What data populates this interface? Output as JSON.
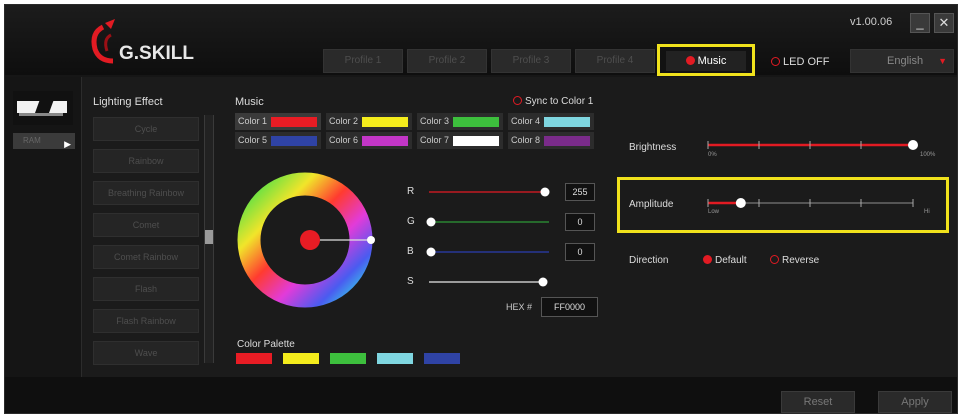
{
  "app": {
    "logo_text": "G.SKILL",
    "version": "v1.00.06",
    "minimize_symbol": "_",
    "close_symbol": "✕"
  },
  "profiles": [
    "Profile 1",
    "Profile 2",
    "Profile 3",
    "Profile 4"
  ],
  "tabs": {
    "music_label": "Music",
    "led_off_label": "LED OFF"
  },
  "language": {
    "selected": "English"
  },
  "sidebar": {
    "module_tag": "RAM"
  },
  "lighting_effect": {
    "title": "Lighting Effect",
    "items": [
      "Cycle",
      "Rainbow",
      "Breathing Rainbow",
      "Comet",
      "Comet Rainbow",
      "Flash",
      "Flash Rainbow",
      "Wave"
    ]
  },
  "music_panel": {
    "title": "Music",
    "sync_label": "Sync to Color 1",
    "colors": [
      {
        "label": "Color 1",
        "swatch": "#e81c24"
      },
      {
        "label": "Color 2",
        "swatch": "#f4ec1c"
      },
      {
        "label": "Color 3",
        "swatch": "#3dbf3d"
      },
      {
        "label": "Color 4",
        "swatch": "#7fd6e0"
      },
      {
        "label": "Color 5",
        "swatch": "#2f43a5"
      },
      {
        "label": "Color 6",
        "swatch": "#c336c7"
      },
      {
        "label": "Color 7",
        "swatch": "#ffffff"
      },
      {
        "label": "Color 8",
        "swatch": "#7a2b8a"
      }
    ],
    "selected_color": "Color 1"
  },
  "rgb": {
    "r_label": "R",
    "r_value": "255",
    "g_label": "G",
    "g_value": "0",
    "b_label": "B",
    "b_value": "0",
    "s_label": "S",
    "hex_label": "HEX #",
    "hex_value": "FF0000",
    "r_level": 1.0,
    "g_level": 0.0,
    "b_level": 0.0,
    "s_level": 1.0
  },
  "palette": {
    "title": "Color Palette",
    "colors": [
      "#e81c24",
      "#f4ec1c",
      "#3dbf3d",
      "#7fd6e0",
      "#2f43a5"
    ]
  },
  "brightness": {
    "label": "Brightness",
    "min_label": "0%",
    "max_label": "100%",
    "level": 1.0
  },
  "amplitude": {
    "label": "Amplitude",
    "min_label": "Low",
    "max_label": "Hi",
    "level": 0.16
  },
  "direction": {
    "label": "Direction",
    "default_label": "Default",
    "reverse_label": "Reverse",
    "selected": "Default"
  },
  "footer": {
    "reset_label": "Reset",
    "apply_label": "Apply"
  },
  "colors": {
    "accent": "#e21b23",
    "highlight": "#f0e21c",
    "background": "#1b1b1b"
  }
}
